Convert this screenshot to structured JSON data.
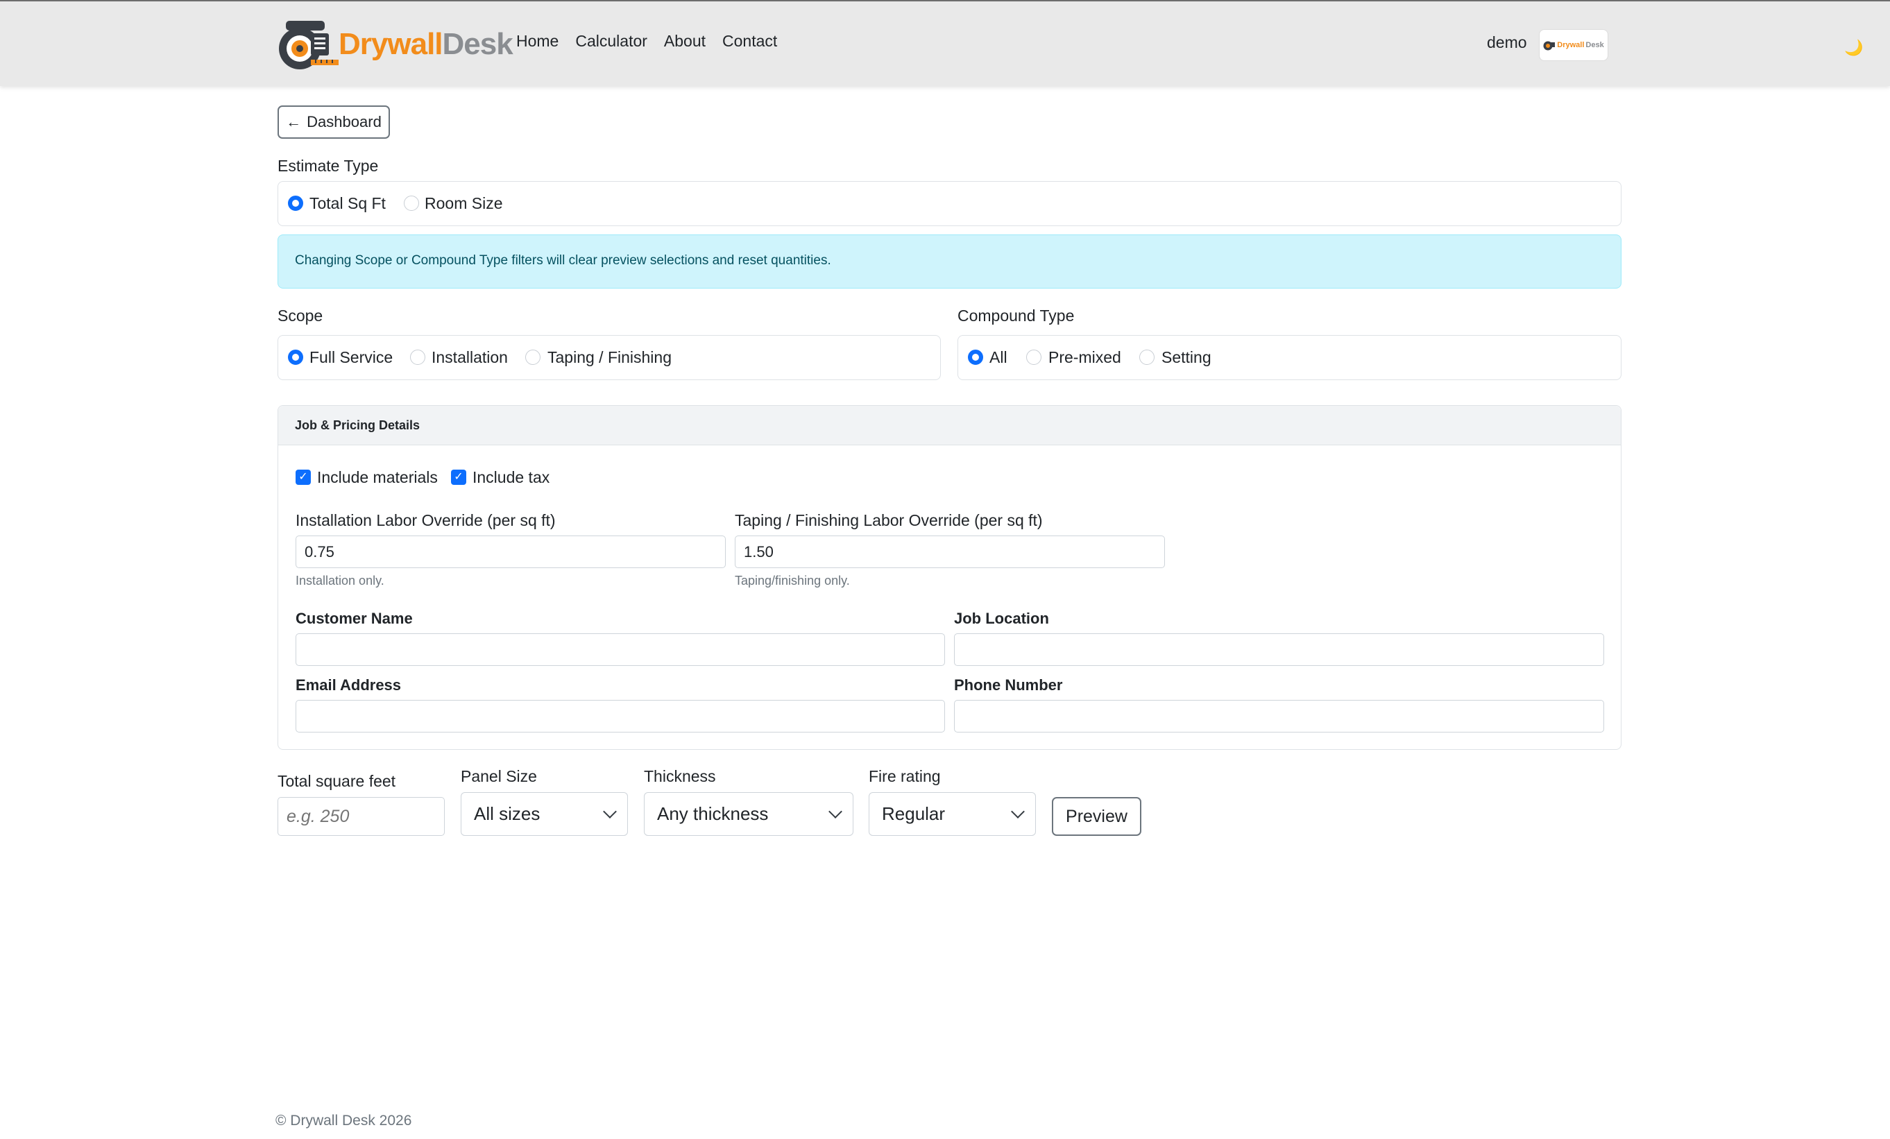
{
  "app": {
    "brand_part1": "Drywall",
    "brand_part2": "Desk",
    "brand_color_primary": "#f28c1b",
    "brand_color_secondary": "#8a8d91"
  },
  "nav": {
    "links": [
      "Home",
      "Calculator",
      "About",
      "Contact"
    ],
    "user": "demo",
    "avatar_part1": "Drywall",
    "avatar_part2": "Desk",
    "theme_icon": "moon-icon"
  },
  "back_button": {
    "icon": "arrow-left-icon",
    "label": "Dashboard"
  },
  "estimate_type": {
    "label": "Estimate Type",
    "options": [
      "Total Sq Ft",
      "Room Size"
    ],
    "selected": "Total Sq Ft"
  },
  "alert": {
    "text": "Changing Scope or Compound Type filters will clear preview selections and reset quantities."
  },
  "scope": {
    "label": "Scope",
    "options": [
      "Full Service",
      "Installation",
      "Taping / Finishing"
    ],
    "selected": "Full Service"
  },
  "compound_type": {
    "label": "Compound Type",
    "options": [
      "All",
      "Pre-mixed",
      "Setting"
    ],
    "selected": "All"
  },
  "job_details": {
    "title": "Job & Pricing Details",
    "include_materials": {
      "label": "Include materials",
      "checked": true
    },
    "include_tax": {
      "label": "Include tax",
      "checked": true
    },
    "install_override": {
      "label": "Installation Labor Override (per sq ft)",
      "value": "0.75",
      "help": "Installation only."
    },
    "taping_override": {
      "label": "Taping / Finishing Labor Override (per sq ft)",
      "value": "1.50",
      "help": "Taping/finishing only."
    },
    "customer_name": {
      "label": "Customer Name",
      "value": ""
    },
    "job_location": {
      "label": "Job Location",
      "value": ""
    },
    "email": {
      "label": "Email Address",
      "value": ""
    },
    "phone": {
      "label": "Phone Number",
      "value": ""
    }
  },
  "calc": {
    "total_sqft": {
      "label": "Total square feet",
      "placeholder": "e.g. 250"
    },
    "panel_size": {
      "label": "Panel Size",
      "selected": "All sizes"
    },
    "thickness": {
      "label": "Thickness",
      "selected": "Any thickness"
    },
    "fire_rating": {
      "label": "Fire rating",
      "selected": "Regular"
    },
    "preview_label": "Preview"
  },
  "footer": {
    "text": "© Drywall Desk 2026"
  },
  "colors": {
    "accent": "#0d6efd",
    "alert_bg": "#cff4fc",
    "alert_text": "#055160"
  }
}
